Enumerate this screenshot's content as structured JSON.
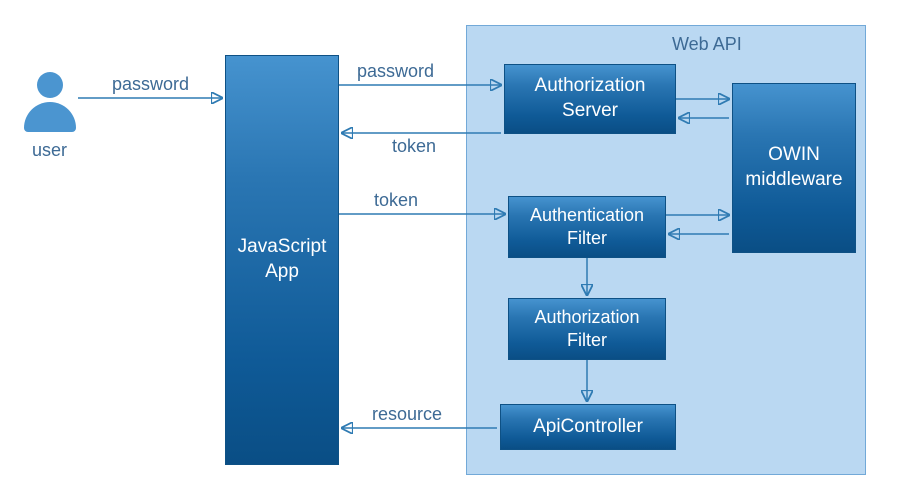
{
  "diagram": {
    "title": "Web API",
    "nodes": {
      "user": "user",
      "js_app_line1": "JavaScript",
      "js_app_line2": "App",
      "auth_server_line1": "Authorization",
      "auth_server_line2": "Server",
      "owin_line1": "OWIN",
      "owin_line2": "middleware",
      "authn_filter_line1": "Authentication",
      "authn_filter_line2": "Filter",
      "authz_filter_line1": "Authorization",
      "authz_filter_line2": "Filter",
      "api_controller": "ApiController"
    },
    "edges": {
      "user_to_app": "password",
      "app_to_as_password": "password",
      "as_to_app_token": "token",
      "app_to_authn_token": "token",
      "api_to_app_resource": "resource"
    },
    "colors": {
      "webapi_bg": "#bad8f2",
      "webapi_border": "#72a9d8",
      "box_top": "#4693cf",
      "box_bottom": "#0a4e85",
      "line": "#2f7bb3",
      "text": "#3d6a95"
    }
  }
}
